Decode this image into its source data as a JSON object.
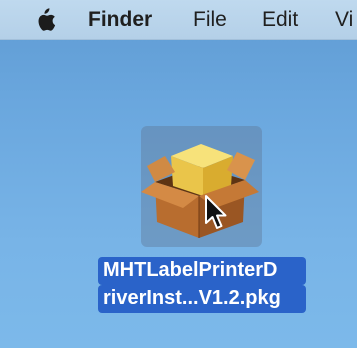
{
  "menubar": {
    "app_name": "Finder",
    "items": [
      "File",
      "Edit",
      "Vi"
    ]
  },
  "desktop": {
    "file": {
      "name_line_1": "MHTLabelPrinterD",
      "name_line_2": "riverInst...V1.2.pkg",
      "icon": "package-box-icon",
      "selected": true
    }
  },
  "colors": {
    "desktop": "#6aa7de",
    "menubar": "#bfd9ee",
    "selection_label": "#2a63c9"
  }
}
